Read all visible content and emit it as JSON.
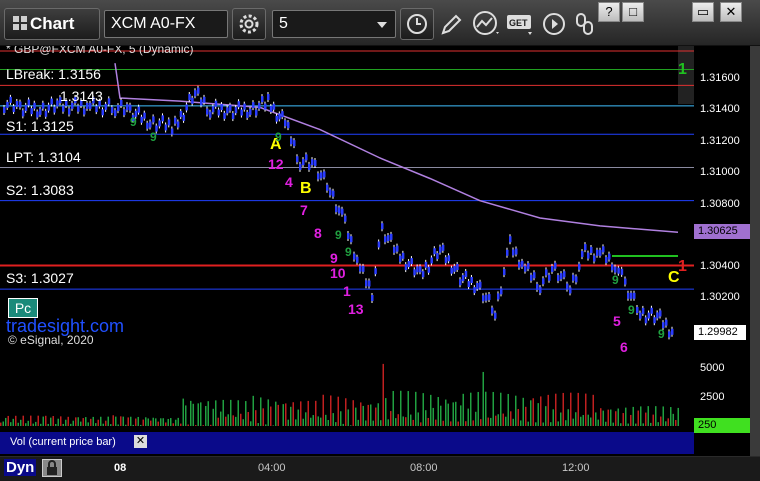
{
  "toolbar": {
    "title": "Chart",
    "symbol": "XCM A0-FX",
    "interval": "5",
    "window_buttons": [
      "?",
      "□",
      "▭",
      "✕"
    ]
  },
  "chart": {
    "info_line": "* GBP@FXCM A0-FX, 5 (Dynamic)",
    "levels": [
      {
        "label": "LBreak: 1.3156",
        "value": 1.3156,
        "color": "#e03030"
      },
      {
        "label": "1.3143",
        "value": 1.3143,
        "color": "#40c0ff"
      },
      {
        "label": "S1: 1.3125",
        "value": 1.3125,
        "color": "#2040ff"
      },
      {
        "label": "LPT: 1.3104",
        "value": 1.3104,
        "color": "#8a8aa0"
      },
      {
        "label": "S2: 1.3083",
        "value": 1.3083,
        "color": "#2040ff"
      },
      {
        "label": "S3: 1.3027",
        "value": 1.3027,
        "color": "#2040ff"
      }
    ],
    "pivot_line": 1.3042,
    "green_line": 1.3166,
    "annotations_yellow": [
      "A",
      "B",
      "C"
    ],
    "annotations_magenta": [
      "12",
      "4",
      "7",
      "8",
      "9",
      "10",
      "1",
      "13",
      "5",
      "6"
    ],
    "annotations_red": [
      "1"
    ],
    "annotations_green": [
      "1"
    ],
    "pc_badge": "Pc",
    "watermark": "tradesight.com",
    "copyright": "© eSignal, 2020",
    "ma_value_label": "1.30625",
    "last_price_label": "1.29982"
  },
  "price_axis": {
    "ticks": [
      "1.31600",
      "1.31400",
      "1.31200",
      "1.31000",
      "1.30800",
      "1.30400",
      "1.30200"
    ],
    "tick_values": [
      1.316,
      1.314,
      1.312,
      1.31,
      1.308,
      1.304,
      1.302
    ]
  },
  "volume_axis": {
    "ticks": [
      "5000",
      "2500"
    ],
    "current_label": "250"
  },
  "volume_panel": {
    "label": "Vol (current price bar)"
  },
  "time_axis": {
    "labels": [
      "08",
      "04:00",
      "08:00",
      "12:00"
    ],
    "left_label": "Dyn"
  },
  "colors": {
    "candle": "#2a3cff",
    "ma": "#b080e0",
    "vol_up": "#20a040",
    "vol_down": "#c02020",
    "level_red": "#e03030",
    "yellow": "#ffff00",
    "magenta": "#e020e0"
  }
}
